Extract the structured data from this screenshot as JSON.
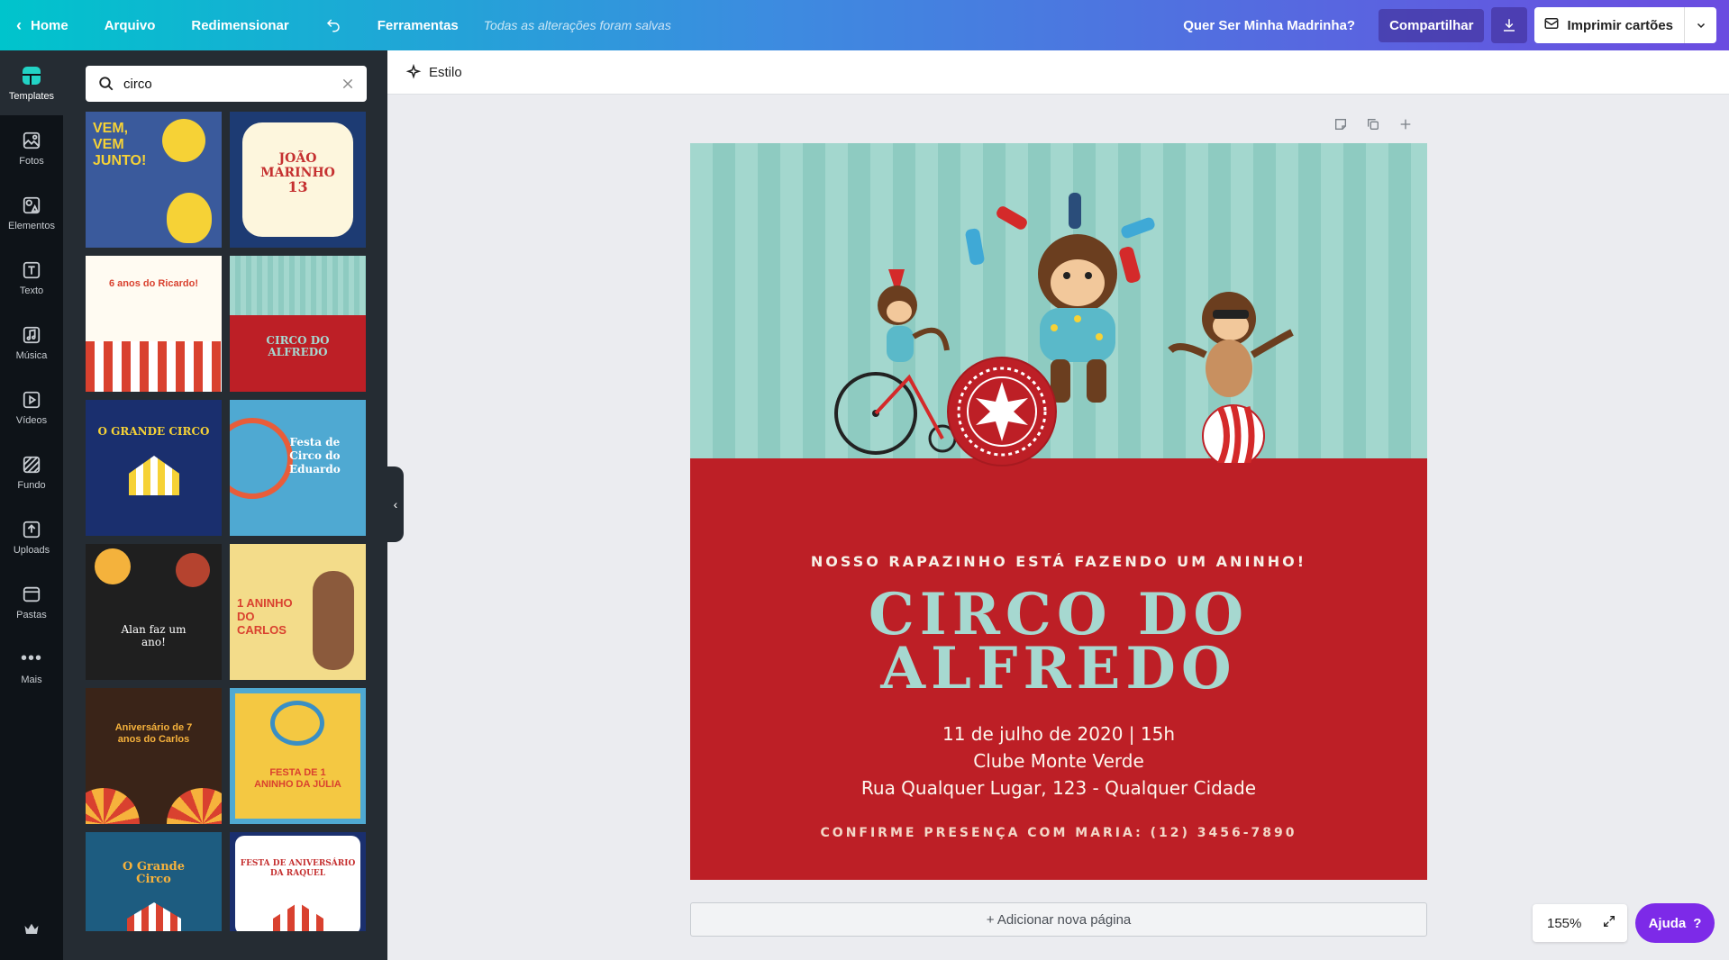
{
  "topbar": {
    "home": "Home",
    "arquivo": "Arquivo",
    "redimensionar": "Redimensionar",
    "ferramentas": "Ferramentas",
    "saved": "Todas as alterações foram salvas",
    "design_name": "Quer Ser Minha Madrinha?",
    "share": "Compartilhar",
    "print": "Imprimir cartões"
  },
  "rail": {
    "items": [
      "Templates",
      "Fotos",
      "Elementos",
      "Texto",
      "Música",
      "Vídeos",
      "Fundo",
      "Uploads",
      "Pastas",
      "Mais"
    ]
  },
  "search": {
    "value": "circo"
  },
  "templates": [
    {
      "lines": [
        "VEM,",
        "VEM",
        "JUNTO!"
      ],
      "bg": "#3a5a9c"
    },
    {
      "lines": [
        "JOÃO",
        "MARINHO",
        "13"
      ],
      "bg": "#1d3b73"
    },
    {
      "lines": [
        "6 anos do Ricardo!"
      ],
      "bg": "#fffbf2"
    },
    {
      "lines": [
        "CIRCO DO",
        "ALFREDO"
      ],
      "bg": "#bd1f26"
    },
    {
      "lines": [
        "O GRANDE CIRCO"
      ],
      "bg": "#1a2f6e"
    },
    {
      "lines": [
        "Festa de",
        "Circo do",
        "Eduardo"
      ],
      "bg": "#4fa9d2"
    },
    {
      "lines": [
        "Alan faz um",
        "ano!"
      ],
      "bg": "#1f1f1f"
    },
    {
      "lines": [
        "1 ANINHO",
        "DO",
        "CARLOS"
      ],
      "bg": "#f3dc8a"
    },
    {
      "lines": [
        "Aniversário de 7",
        "anos do Carlos"
      ],
      "bg": "#3a2418"
    },
    {
      "lines": [
        "FESTA DE 1",
        "ANINHO DA JÚLIA"
      ],
      "bg": "#f4c842"
    },
    {
      "lines": [
        "O Grande",
        "Circo"
      ],
      "bg": "#1d5c80"
    },
    {
      "lines": [
        "FESTA DE ANIVERSÁRIO",
        "DA RAQUEL"
      ],
      "bg": "#ffffff"
    }
  ],
  "editor": {
    "estilo": "Estilo",
    "add_page": "+ Adicionar nova página",
    "zoom": "155%",
    "help": "Ajuda"
  },
  "card": {
    "subtitle": "NOSSO RAPAZINHO ESTÁ FAZENDO UM ANINHO!",
    "title_line1": "CIRCO DO",
    "title_line2": "ALFREDO",
    "date": "11 de julho de 2020 | 15h",
    "place": "Clube Monte Verde",
    "address": "Rua Qualquer Lugar, 123 - Qualquer Cidade",
    "rsvp": "CONFIRME PRESENÇA COM MARIA: (12) 3456-7890",
    "colors": {
      "red": "#bd1f26",
      "mint": "#a3d7ce"
    }
  }
}
